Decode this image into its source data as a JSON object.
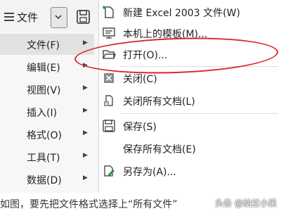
{
  "toolbar": {
    "file_label": "文件"
  },
  "left_menu": {
    "items": [
      {
        "label": "文件(F)",
        "active": true
      },
      {
        "label": "编辑(E)"
      },
      {
        "label": "视图(V)"
      },
      {
        "label": "插入(I)"
      },
      {
        "label": "格式(O)"
      },
      {
        "label": "工具(T)"
      },
      {
        "label": "数据(D)"
      }
    ]
  },
  "file_menu": {
    "items": [
      {
        "label": "新建 Excel 2003 文件(W)",
        "icon": "new-file-icon"
      },
      {
        "label": "本机上的模板(M)...",
        "icon": "template-icon"
      },
      {
        "label": "打开(O)...",
        "icon": "folder-open-icon"
      },
      {
        "label": "关闭(C)",
        "icon": "close-icon"
      },
      {
        "label": "关闭所有文档(L)",
        "icon": "close-all-icon"
      },
      {
        "label": "保存(S)",
        "icon": "save-icon"
      },
      {
        "label": "保存所有文档(E)",
        "icon": ""
      },
      {
        "label": "另存为(A)...",
        "icon": "save-as-icon"
      }
    ]
  },
  "caption": {
    "text": "如图，要先把文件格式选择上“所有文件”"
  },
  "watermark": {
    "text": "头条 @纳兰小采"
  },
  "colors": {
    "highlight_ellipse": "#d9252a"
  }
}
